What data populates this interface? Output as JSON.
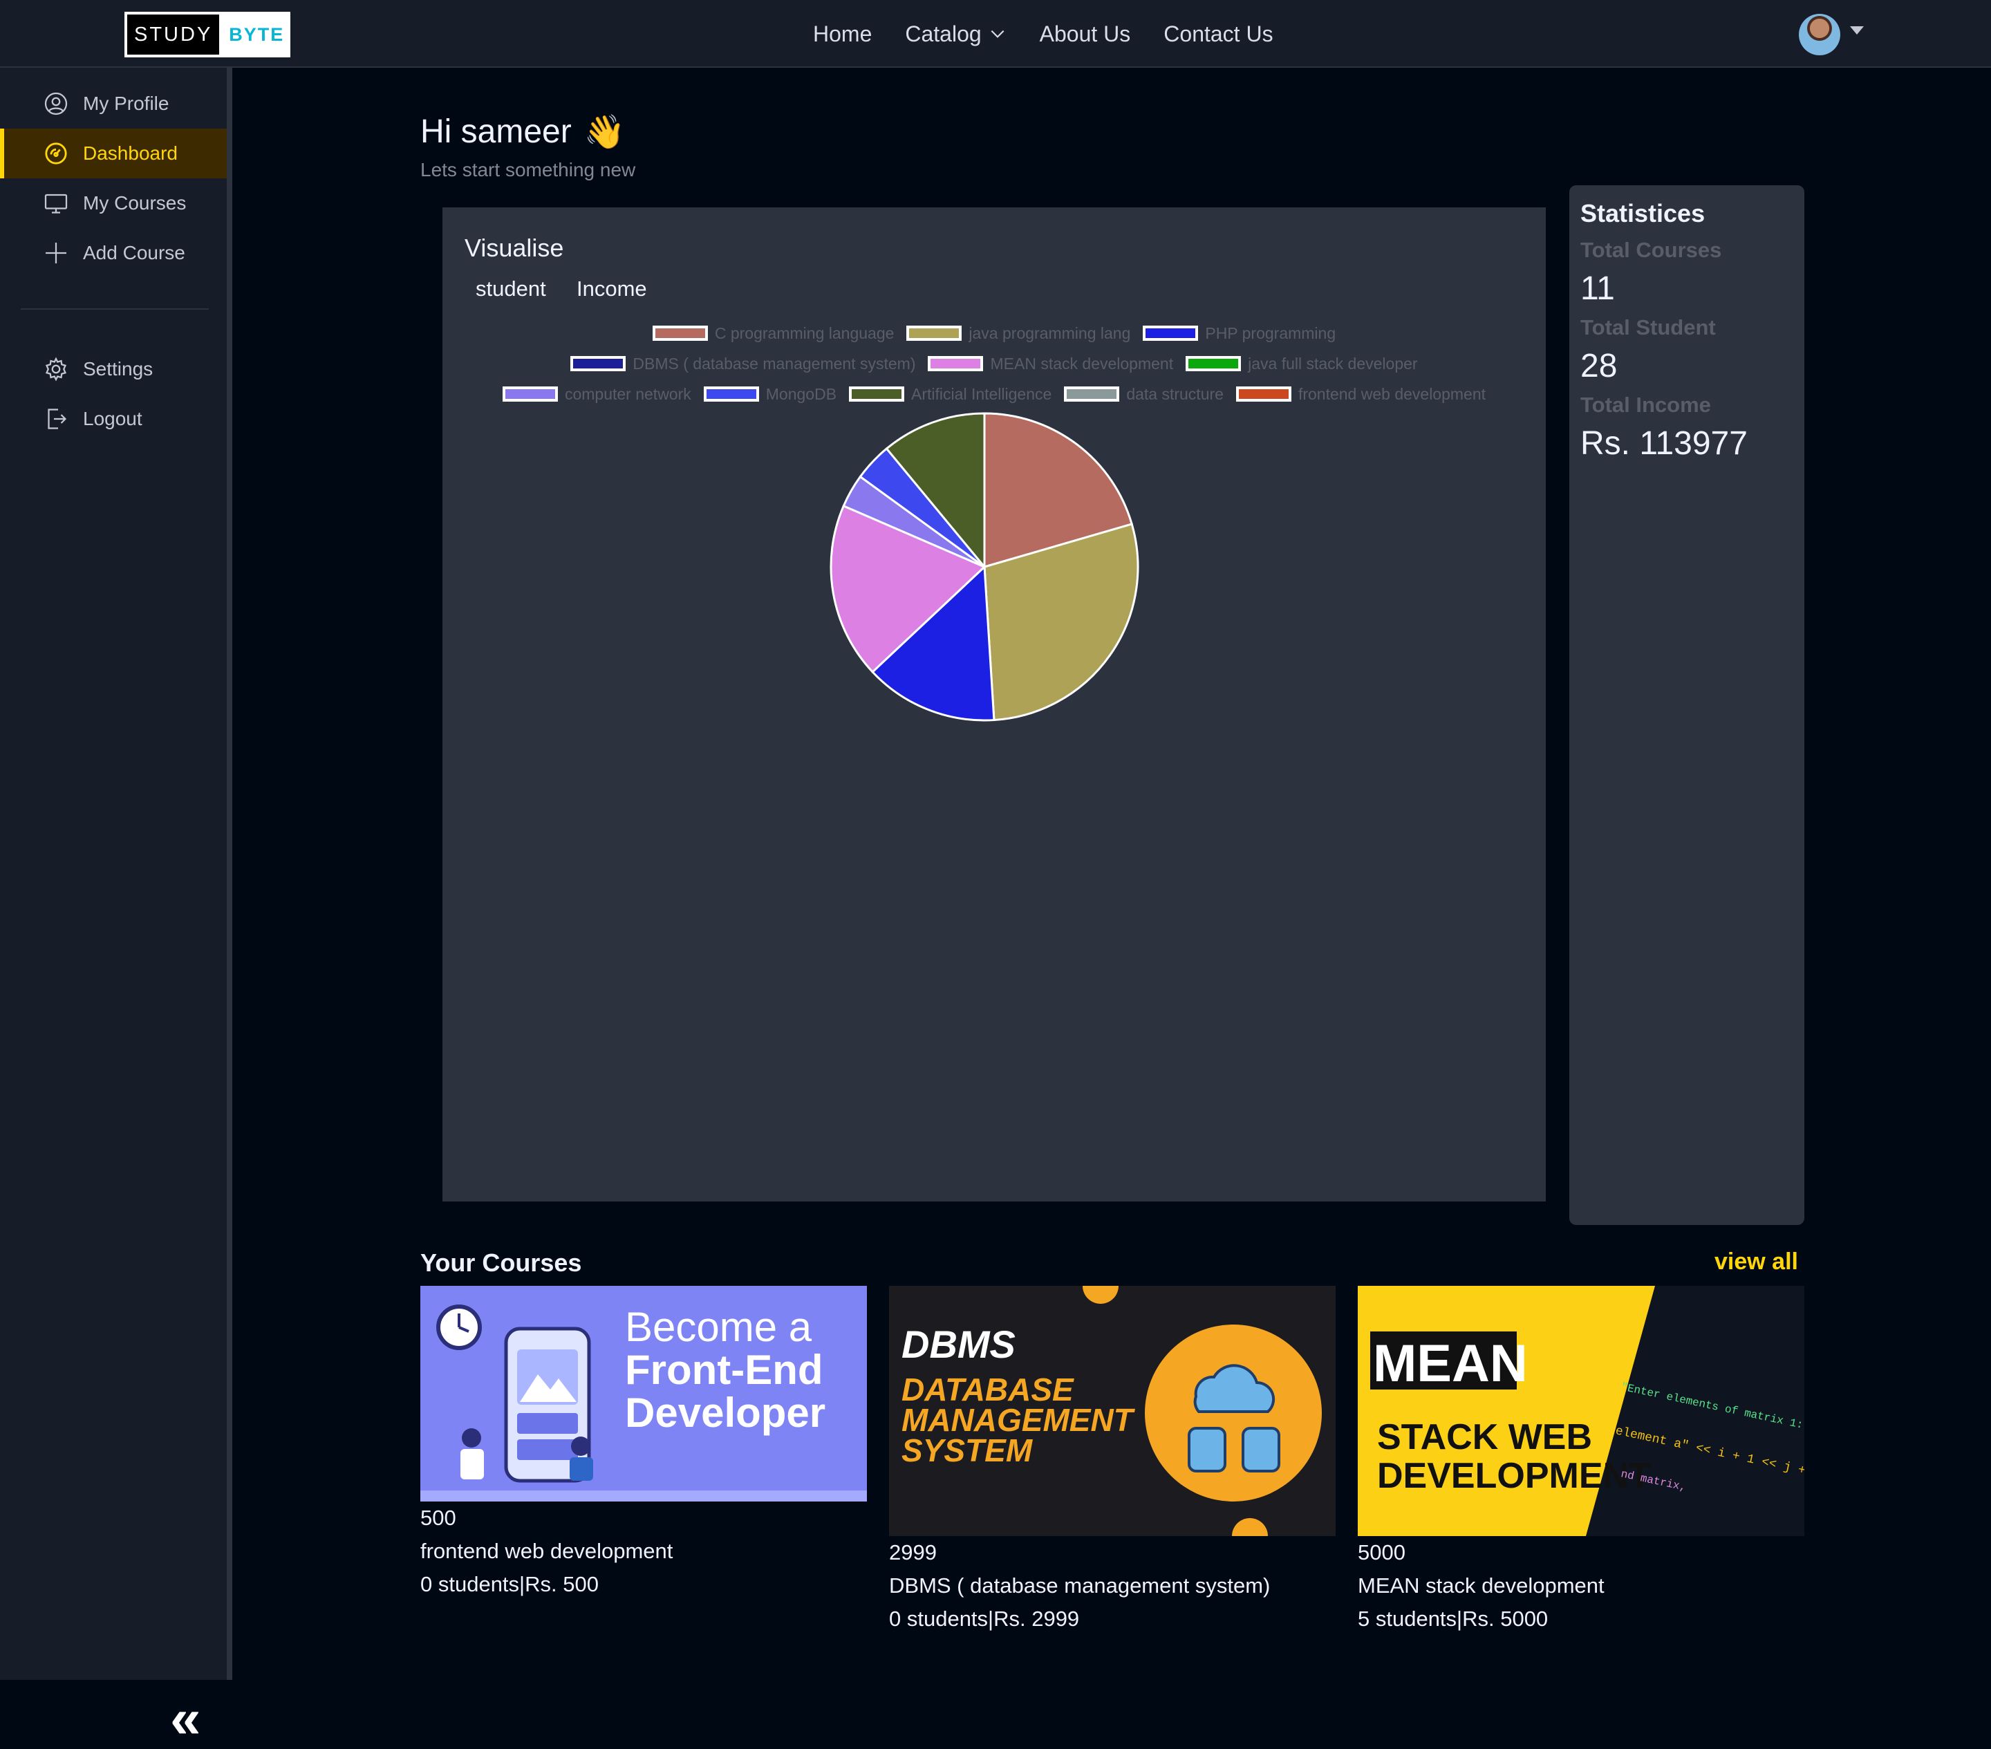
{
  "logo": {
    "part1": "STUDY",
    "part2": "BYTE"
  },
  "nav": {
    "home": "Home",
    "catalog": "Catalog",
    "about": "About Us",
    "contact": "Contact Us"
  },
  "sidebar": {
    "items": [
      {
        "label": "My Profile",
        "icon": "user-circle-icon"
      },
      {
        "label": "Dashboard",
        "icon": "gauge-icon",
        "active": true
      },
      {
        "label": "My Courses",
        "icon": "monitor-icon"
      },
      {
        "label": "Add Course",
        "icon": "plus-icon"
      },
      {
        "label": "Settings",
        "icon": "gear-icon"
      },
      {
        "label": "Logout",
        "icon": "logout-icon"
      }
    ],
    "collapse_label": "«"
  },
  "greeting": {
    "title": "Hi sameer",
    "emoji": "👋",
    "subtitle": "Lets start something new"
  },
  "visualise": {
    "title": "Visualise",
    "tabs": [
      "student",
      "Income"
    ]
  },
  "chart_data": {
    "type": "pie",
    "title": "",
    "legend_position": "top",
    "series": [
      {
        "name": "C programming language",
        "value": 20.5,
        "color": "#b66b60"
      },
      {
        "name": "java programming lang",
        "value": 28.5,
        "color": "#ada255"
      },
      {
        "name": "PHP programming",
        "value": 14,
        "color": "#1b20e3"
      },
      {
        "name": "DBMS ( database management system)",
        "value": 0,
        "color": "#1c1d98"
      },
      {
        "name": "MEAN stack development",
        "value": 18.5,
        "color": "#dc80e4"
      },
      {
        "name": "java full stack developer",
        "value": 0,
        "color": "#0aa80a"
      },
      {
        "name": "computer network",
        "value": 3.5,
        "color": "#8a79ee"
      },
      {
        "name": "MongoDB",
        "value": 4,
        "color": "#3d49ee"
      },
      {
        "name": "Artificial Intelligence",
        "value": 11,
        "color": "#4b5e27"
      },
      {
        "name": "data structure",
        "value": 0,
        "color": "#8a9a9a"
      },
      {
        "name": "frontend web development",
        "value": 0,
        "color": "#cc4920"
      }
    ]
  },
  "stats": {
    "title": "Statistices",
    "total_courses_label": "Total Courses",
    "total_courses": "11",
    "total_students_label": "Total Student",
    "total_students": "28",
    "total_income_label": "Total Income",
    "total_income": "Rs. 113977"
  },
  "courses": {
    "title": "Your Courses",
    "view_all": "view all",
    "items": [
      {
        "price": "500",
        "name": "frontend web development",
        "meta": "0 students|Rs. 500",
        "thumb_text": [
          "Become a",
          "Front-End",
          "Developer"
        ]
      },
      {
        "price": "2999",
        "name": "DBMS ( database management system)",
        "meta": "0 students|Rs. 2999",
        "thumb_text": [
          "DBMS",
          "DATABASE",
          "MANAGEMENT",
          "SYSTEM"
        ]
      },
      {
        "price": "5000",
        "name": "MEAN stack development",
        "meta": "5 students|Rs. 5000",
        "thumb_text": [
          "MEAN",
          "STACK WEB",
          "DEVELOPMENT"
        ]
      }
    ]
  }
}
